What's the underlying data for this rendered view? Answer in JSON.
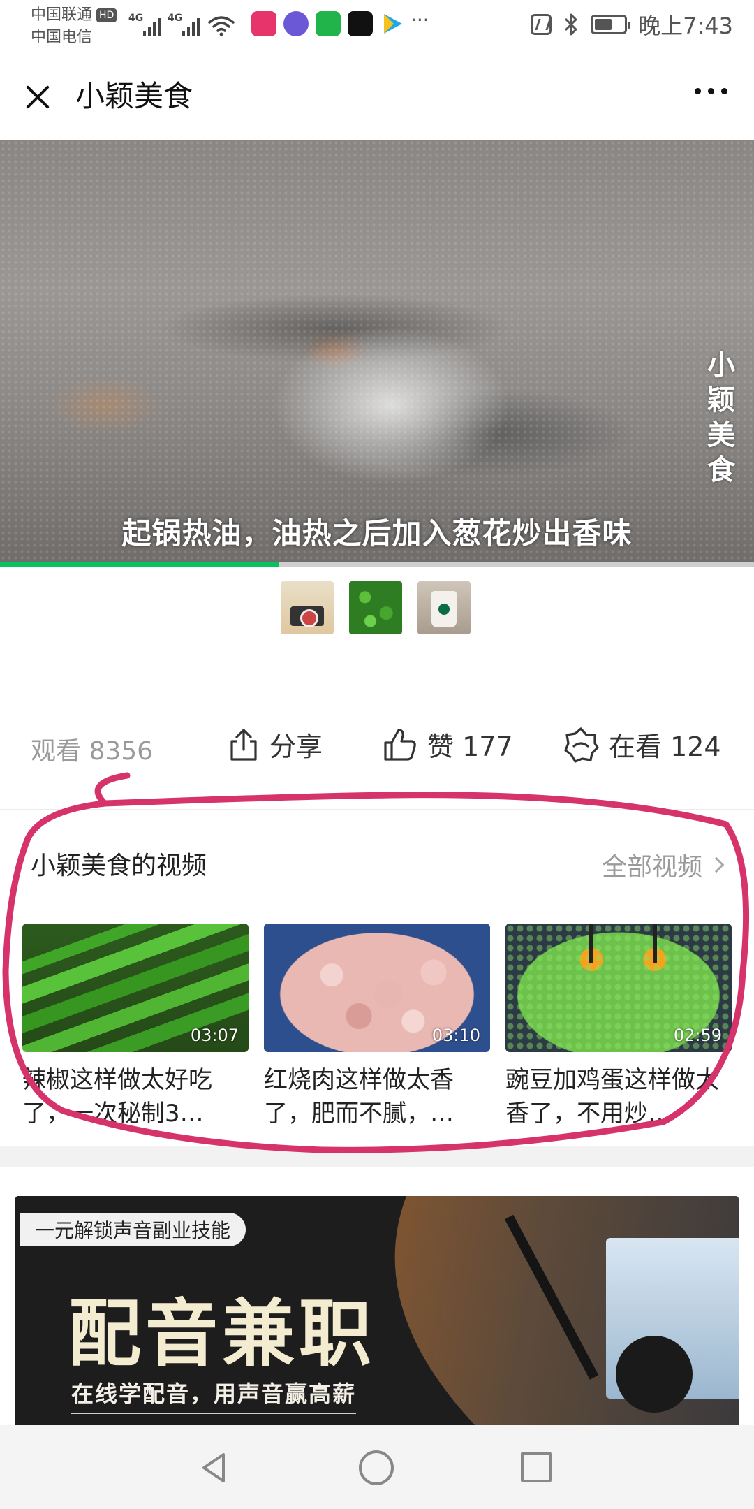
{
  "status_bar": {
    "carrier_1": "中国联通",
    "hd_badge": "HD",
    "carrier_2": "中国电信",
    "network_1": "4G",
    "network_2": "4G",
    "time": "晚上7:43",
    "more": "···",
    "app_icons": [
      "music-app-icon",
      "chat-app-icon",
      "iqiyi-app-icon",
      "tiktok-app-icon",
      "video-app-icon"
    ]
  },
  "header": {
    "title": "小颖美食"
  },
  "video": {
    "watermark": "小颖美食",
    "subtitle": "起锅热油，油热之后加入葱花炒出香味",
    "progress": 0.37,
    "progress_color": "#07c160"
  },
  "stats": {
    "views": "观看 8356",
    "share_label": "分享",
    "like_label": "赞 177",
    "watching_label": "在看 124"
  },
  "channel_videos": {
    "heading": "小颖美食的视频",
    "all_link": "全部视频",
    "items": [
      {
        "duration": "03:07",
        "title": "辣椒这样做太好吃了，一次秘制3…"
      },
      {
        "duration": "03:10",
        "title": "红烧肉这样做太香了，肥而不腻，…"
      },
      {
        "duration": "02:59",
        "title": "豌豆加鸡蛋这样做太香了，不用炒…"
      }
    ]
  },
  "ad": {
    "tag": "一元解锁声音副业技能",
    "headline": "配音兼职",
    "subline": "在线学配音，用声音赢高薪"
  },
  "colors": {
    "annotation": "#d6336c",
    "accent_green": "#07c160"
  }
}
